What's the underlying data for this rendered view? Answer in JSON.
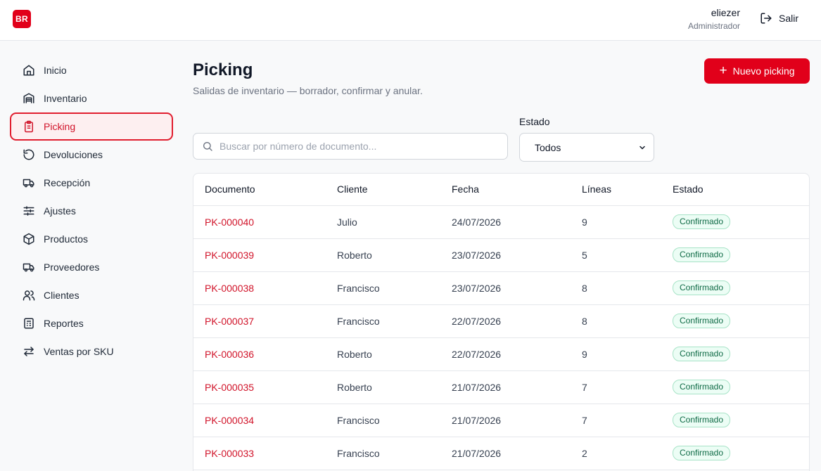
{
  "header": {
    "logo_text": "BR",
    "user_name": "eliezer",
    "user_role": "Administrador",
    "logout_label": "Salir"
  },
  "sidebar": {
    "items": [
      {
        "label": "Inicio",
        "icon": "home-icon"
      },
      {
        "label": "Inventario",
        "icon": "warehouse-icon"
      },
      {
        "label": "Picking",
        "icon": "clipboard-icon",
        "active": true
      },
      {
        "label": "Devoluciones",
        "icon": "undo-icon"
      },
      {
        "label": "Recepción",
        "icon": "truck-icon"
      },
      {
        "label": "Ajustes",
        "icon": "sliders-icon"
      },
      {
        "label": "Productos",
        "icon": "box-icon"
      },
      {
        "label": "Proveedores",
        "icon": "truck-icon"
      },
      {
        "label": "Clientes",
        "icon": "users-icon"
      },
      {
        "label": "Reportes",
        "icon": "report-icon"
      },
      {
        "label": "Ventas por SKU",
        "icon": "arrows-icon"
      }
    ]
  },
  "main": {
    "title": "Picking",
    "subtitle": "Salidas de inventario — borrador, confirmar y anular.",
    "new_button": "Nuevo picking",
    "search_placeholder": "Buscar por número de documento...",
    "estado_label": "Estado",
    "estado_value": "Todos"
  },
  "table": {
    "columns": [
      "Documento",
      "Cliente",
      "Fecha",
      "Líneas",
      "Estado"
    ],
    "rows": [
      [
        "PK-000040",
        "Julio",
        "24/07/2026",
        "9",
        "Confirmado"
      ],
      [
        "PK-000039",
        "Roberto",
        "23/07/2026",
        "5",
        "Confirmado"
      ],
      [
        "PK-000038",
        "Francisco",
        "23/07/2026",
        "8",
        "Confirmado"
      ],
      [
        "PK-000037",
        "Francisco",
        "22/07/2026",
        "8",
        "Confirmado"
      ],
      [
        "PK-000036",
        "Roberto",
        "22/07/2026",
        "9",
        "Confirmado"
      ],
      [
        "PK-000035",
        "Roberto",
        "21/07/2026",
        "7",
        "Confirmado"
      ],
      [
        "PK-000034",
        "Francisco",
        "21/07/2026",
        "7",
        "Confirmado"
      ],
      [
        "PK-000033",
        "Francisco",
        "21/07/2026",
        "2",
        "Confirmado"
      ],
      [
        "",
        "",
        "",
        "",
        ""
      ]
    ]
  },
  "colors": {
    "accent": "#e1001a",
    "link": "#d1142a",
    "badge_text": "#0f6b46",
    "badge_bg": "#ecfdf5"
  }
}
